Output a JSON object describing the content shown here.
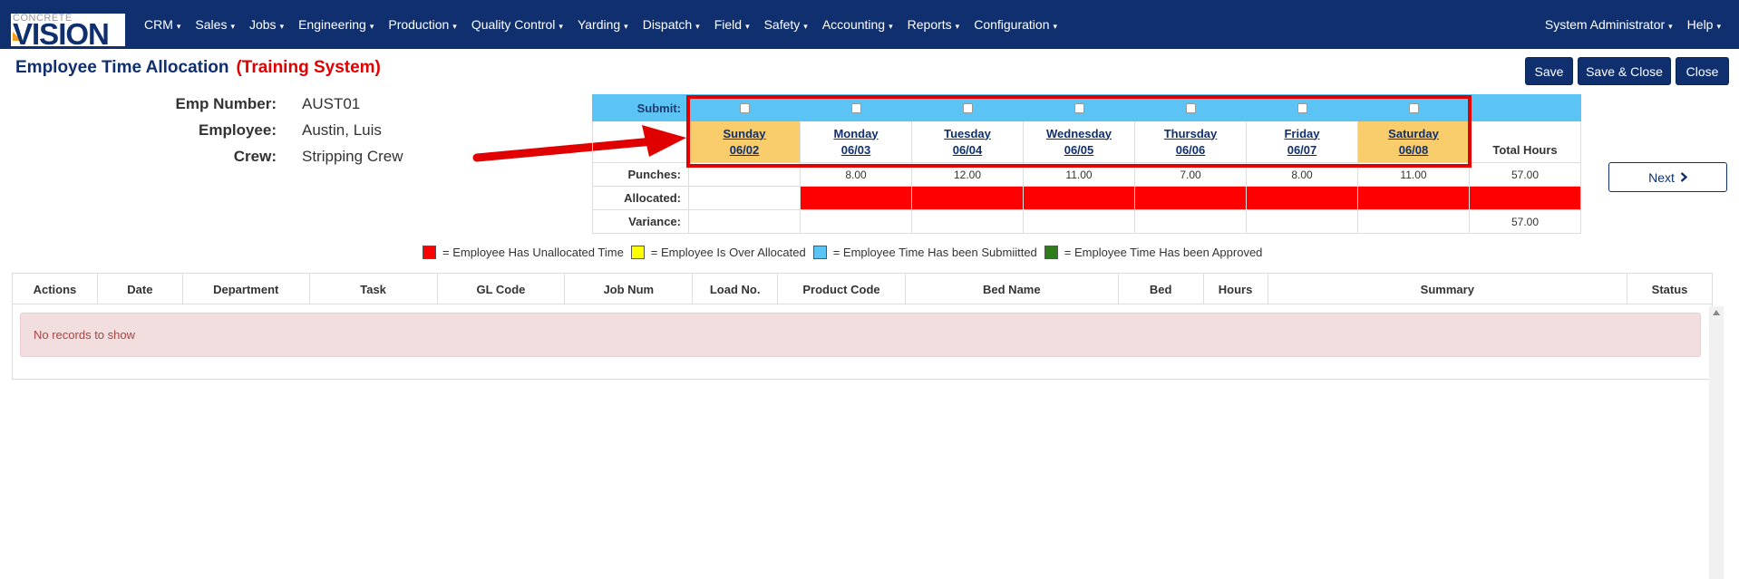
{
  "brand": {
    "top": "CONCRETE",
    "main": "VISION"
  },
  "nav": {
    "items": [
      "CRM",
      "Sales",
      "Jobs",
      "Engineering",
      "Production",
      "Quality Control",
      "Yarding",
      "Dispatch",
      "Field",
      "Safety",
      "Accounting",
      "Reports",
      "Configuration"
    ],
    "user": "System Administrator",
    "help": "Help"
  },
  "page": {
    "title": "Employee Time Allocation",
    "subtitle": "(Training System)"
  },
  "buttons": {
    "save": "Save",
    "save_close": "Save & Close",
    "close": "Close",
    "next": "Next"
  },
  "employee": {
    "emp_number_label": "Emp Number:",
    "emp_number": "AUST01",
    "employee_label": "Employee:",
    "employee": "Austin, Luis",
    "crew_label": "Crew:",
    "crew": "Stripping Crew"
  },
  "week": {
    "row_labels": {
      "submit": "Submit:",
      "punches": "Punches:",
      "allocated": "Allocated:",
      "variance": "Variance:"
    },
    "total_label": "Total Hours",
    "days": [
      {
        "name": "Sunday",
        "date": "06/02",
        "punches": "",
        "weekend": true
      },
      {
        "name": "Monday",
        "date": "06/03",
        "punches": "8.00",
        "weekend": false
      },
      {
        "name": "Tuesday",
        "date": "06/04",
        "punches": "12.00",
        "weekend": false
      },
      {
        "name": "Wednesday",
        "date": "06/05",
        "punches": "11.00",
        "weekend": false
      },
      {
        "name": "Thursday",
        "date": "06/06",
        "punches": "7.00",
        "weekend": false
      },
      {
        "name": "Friday",
        "date": "06/07",
        "punches": "8.00",
        "weekend": false
      },
      {
        "name": "Saturday",
        "date": "06/08",
        "punches": "11.00",
        "weekend": true
      }
    ],
    "total_punches": "57.00",
    "total_variance": "57.00"
  },
  "legend": [
    {
      "color": "#ff0000",
      "text": "= Employee Has Unallocated Time"
    },
    {
      "color": "#ffff00",
      "text": "= Employee Is Over Allocated"
    },
    {
      "color": "#5bc4f5",
      "text": "= Employee Time Has been Submiitted"
    },
    {
      "color": "#2e7d1a",
      "text": "= Employee Time Has been Approved"
    }
  ],
  "grid": {
    "columns": [
      "Actions",
      "Date",
      "Department",
      "Task",
      "GL Code",
      "Job Num",
      "Load No.",
      "Product Code",
      "Bed Name",
      "Bed",
      "Hours",
      "Summary",
      "Status"
    ],
    "empty_message": "No records to show"
  }
}
